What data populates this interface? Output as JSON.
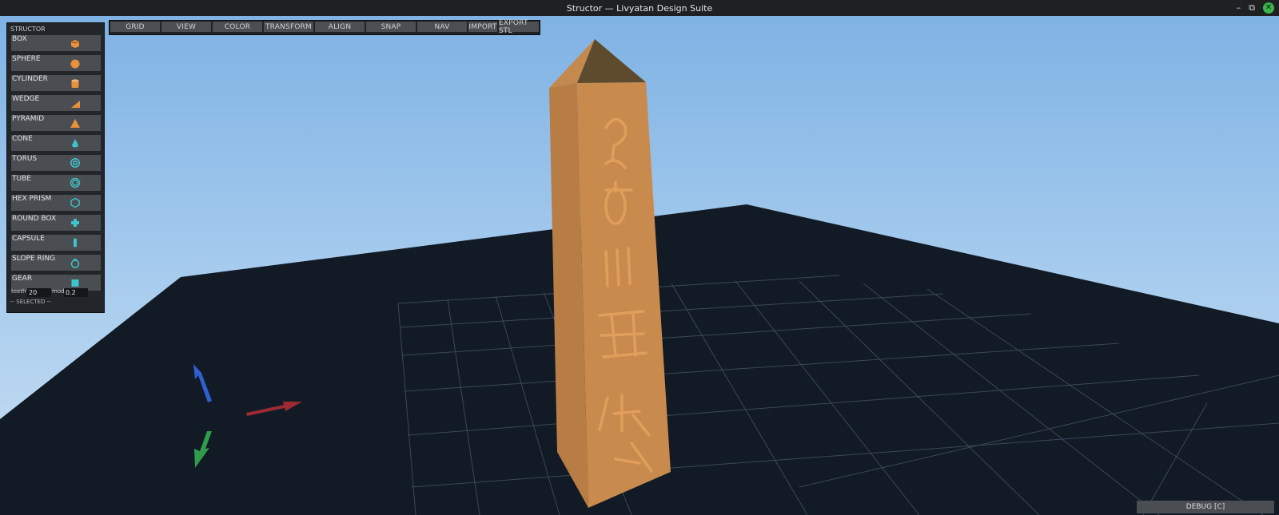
{
  "window": {
    "title": "Structor — Livyatan Design Suite"
  },
  "toolbar": {
    "items": [
      "GRID",
      "VIEW",
      "COLOR",
      "TRANSFORM",
      "ALIGN",
      "SNAP",
      "NAV",
      "IMPORT",
      "EXPORT STL"
    ]
  },
  "panel": {
    "title": "STRUCTOR",
    "tools": [
      {
        "label": "BOX",
        "icon": "box-icon"
      },
      {
        "label": "SPHERE",
        "icon": "sphere-icon"
      },
      {
        "label": "CYLINDER",
        "icon": "cylinder-icon"
      },
      {
        "label": "WEDGE",
        "icon": "wedge-icon"
      },
      {
        "label": "PYRAMID",
        "icon": "pyramid-icon"
      },
      {
        "label": "CONE",
        "icon": "cone-icon"
      },
      {
        "label": "TORUS",
        "icon": "torus-icon"
      },
      {
        "label": "TUBE",
        "icon": "tube-icon"
      },
      {
        "label": "HEX PRISM",
        "icon": "hex-prism-icon"
      },
      {
        "label": "ROUND BOX",
        "icon": "round-box-icon"
      },
      {
        "label": "CAPSULE",
        "icon": "capsule-icon"
      },
      {
        "label": "SLOPE RING",
        "icon": "slope-ring-icon"
      },
      {
        "label": "GEAR",
        "icon": "gear-icon"
      }
    ],
    "params": {
      "teeth_label": "teeth",
      "teeth_value": "20",
      "mod_label": "mod",
      "mod_value": "0.2"
    },
    "selected_label": "-- SELECTED --"
  },
  "debug": {
    "label": "DEBUG [C]"
  },
  "colors": {
    "accent_orange": "#e8913a",
    "accent_teal": "#3fc4c9",
    "axis_x": "#9b2a33",
    "axis_y": "#2f5fd0",
    "axis_z": "#2e9c4a",
    "obelisk": "#c98a4e"
  }
}
